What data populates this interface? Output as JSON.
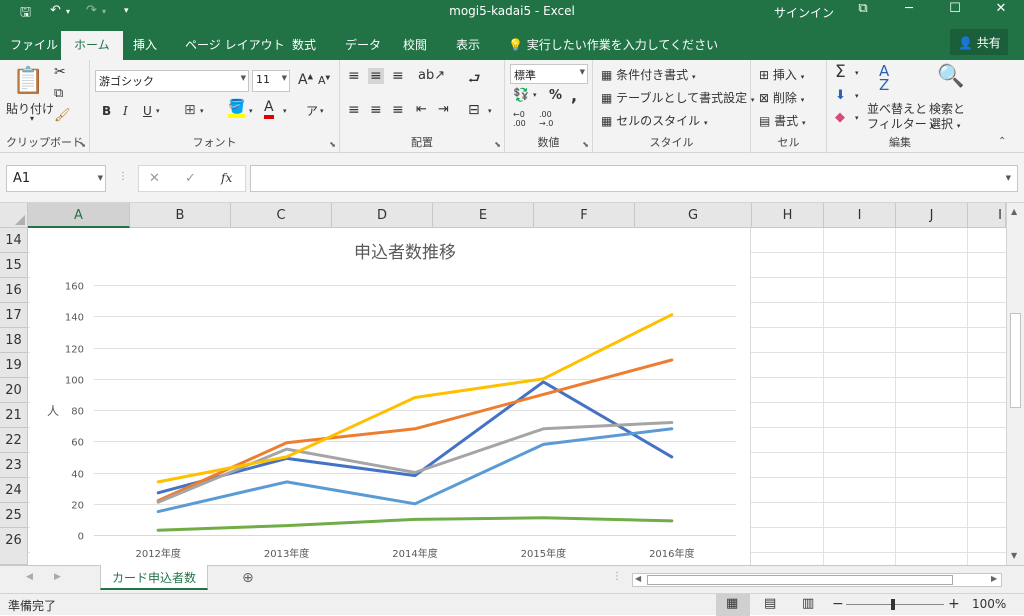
{
  "window": {
    "title": "mogi5-kadai5  -  Excel",
    "signin": "サインイン",
    "controls": {
      "options": "⧉",
      "minimize": "─",
      "maximize": "☐",
      "close": "✕"
    },
    "qat": {
      "save": "🖫",
      "undo": "↶",
      "redo": "↷",
      "more": "▾"
    }
  },
  "ribbon_tabs": [
    "ファイル",
    "ホーム",
    "挿入",
    "ページ レイアウト",
    "数式",
    "データ",
    "校閲",
    "表示"
  ],
  "active_tab": "ホーム",
  "tell_me": "実行したい作業を入力してください",
  "share": "共有",
  "clipboard": {
    "label": "クリップボード",
    "paste": "貼り付け"
  },
  "font": {
    "label": "フォント",
    "name": "游ゴシック",
    "size": "11",
    "bold": "B",
    "italic": "I",
    "underline": "U",
    "grow": "A",
    "shrink": "A",
    "font_color": "A"
  },
  "alignment": {
    "label": "配置"
  },
  "number": {
    "label": "数値",
    "format": "標準",
    "percent": "%",
    "comma": ","
  },
  "styles": {
    "label": "スタイル",
    "conditional": "条件付き書式",
    "table": "テーブルとして書式設定",
    "cell_styles": "セルのスタイル"
  },
  "cells": {
    "label": "セル",
    "insert": "挿入",
    "delete": "削除",
    "format": "書式"
  },
  "editing": {
    "label": "編集",
    "sum": "Σ",
    "sort": "並べ替えと",
    "sort2": "フィルター",
    "find": "検索と",
    "find2": "選択"
  },
  "name_box": "A1",
  "formula_bar": {
    "cancel": "✕",
    "enter": "✓",
    "fx": "fx",
    "value": ""
  },
  "columns": [
    "A",
    "B",
    "C",
    "D",
    "E",
    "F",
    "G",
    "H",
    "I",
    "J",
    "I"
  ],
  "rows": [
    "14",
    "15",
    "16",
    "17",
    "18",
    "19",
    "20",
    "21",
    "22",
    "23",
    "24",
    "25",
    "26"
  ],
  "chart_data": {
    "type": "line",
    "title": "申込者数推移",
    "ylabel": "人",
    "xlabel": "",
    "categories": [
      "2012年度",
      "2013年度",
      "2014年度",
      "2015年度",
      "2016年度"
    ],
    "ylim": [
      0,
      160
    ],
    "yticks": [
      0,
      20,
      40,
      60,
      80,
      100,
      120,
      140,
      160
    ],
    "grid": true,
    "series": [
      {
        "color": "#4472C4",
        "values": [
          27,
          49,
          38,
          98,
          50
        ]
      },
      {
        "color": "#ED7D31",
        "values": [
          22,
          59,
          68,
          90,
          112
        ]
      },
      {
        "color": "#A5A5A5",
        "values": [
          21,
          55,
          40,
          68,
          72
        ]
      },
      {
        "color": "#FFC000",
        "values": [
          34,
          50,
          88,
          100,
          141
        ]
      },
      {
        "color": "#5B9BD5",
        "values": [
          15,
          34,
          20,
          58,
          68
        ]
      },
      {
        "color": "#70AD47",
        "values": [
          3,
          6,
          10,
          11,
          9
        ]
      }
    ]
  },
  "sheet_tab": "カード申込者数",
  "status": {
    "ready": "準備完了",
    "zoom": "100%",
    "minus": "−",
    "plus": "+"
  }
}
